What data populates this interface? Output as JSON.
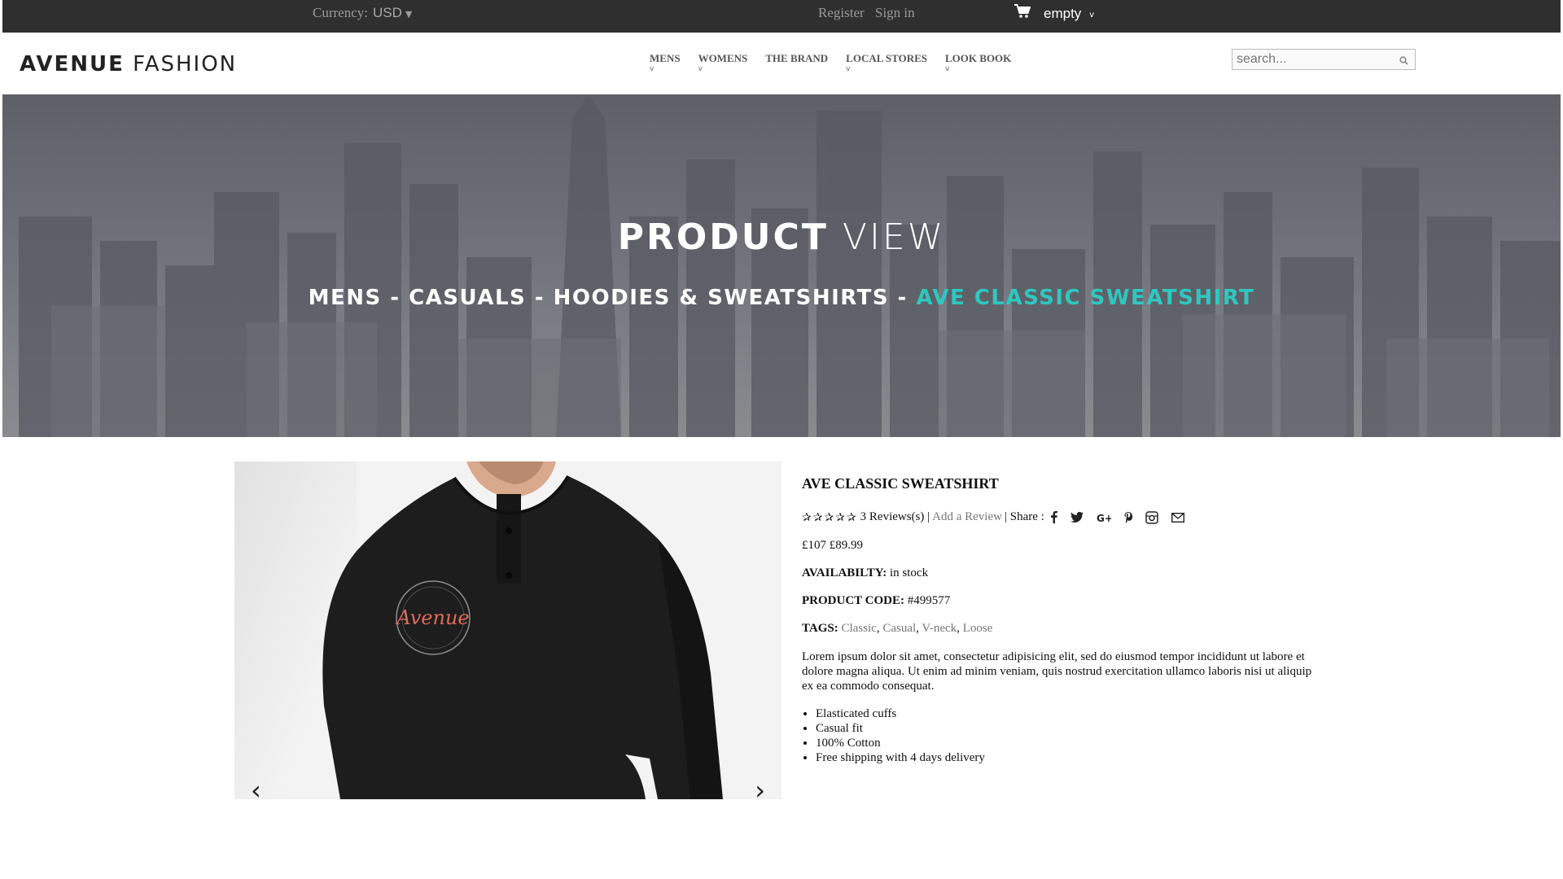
{
  "topbar": {
    "currency_label": "Currency:",
    "currency_value": "USD",
    "register": "Register",
    "signin": "Sign in",
    "cart_status": "empty"
  },
  "header": {
    "logo_bold": "AVENUE",
    "logo_thin": "FASHION",
    "nav": [
      {
        "label": "MENS",
        "sub": "v"
      },
      {
        "label": "WOMENS",
        "sub": "v"
      },
      {
        "label": "THE BRAND",
        "sub": ""
      },
      {
        "label": "LOCAL STORES",
        "sub": "v"
      },
      {
        "label": "LOOK BOOK",
        "sub": "v"
      }
    ],
    "search_placeholder": "search..."
  },
  "hero": {
    "title_bold": "PRODUCT",
    "title_light": "VIEW",
    "breadcrumb": "MENS - CASUALS - HOODIES & SWEATSHIRTS - ",
    "breadcrumb_current": "AVE CLASSIC SWEATSHIRT"
  },
  "product": {
    "name": "AVE CLASSIC SWEATSHIRT",
    "stars": "✰✰✰✰✰",
    "reviews": "3 Reviews(s) |",
    "add_review": "Add a Review",
    "share_label": "| Share :",
    "price_old": "£107",
    "price_new": "£89.99",
    "availability_label": "AVAILABILTY:",
    "availability_value": "in stock",
    "code_label": "PRODUCT CODE:",
    "code_value": "#499577",
    "tags_label": "TAGS:",
    "tags": [
      "Classic",
      "Casual",
      "V-neck",
      "Loose"
    ],
    "description": "Lorem ipsum dolor sit amet, consectetur adipisicing elit, sed do eiusmod tempor incididunt ut labore et dolore magna aliqua. Ut enim ad minim veniam, quis nostrud exercitation ullamco laboris nisi ut aliquip ex ea commodo consequat.",
    "features": [
      "Elasticated cuffs",
      "Casual fit",
      "100% Cotton",
      "Free shipping with 4 days delivery"
    ],
    "badge_text": "Avenue"
  },
  "colors": {
    "topbar_bg": "#2f2f2f",
    "accent": "#2fc7bf",
    "shirt": "#1d1d1d",
    "badge_text": "#e06a5a"
  },
  "icons": [
    "cart-icon",
    "search-icon",
    "facebook-icon",
    "twitter-icon",
    "google-plus-icon",
    "pinterest-icon",
    "instagram-icon",
    "email-icon",
    "prev-arrow-icon",
    "next-arrow-icon"
  ]
}
